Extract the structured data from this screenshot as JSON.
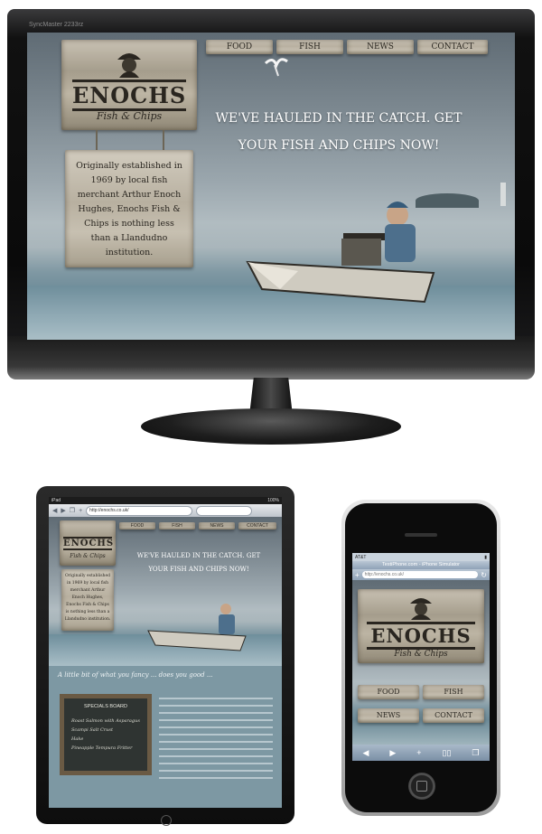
{
  "monitor": {
    "brand": "SyncMaster 2233rz",
    "nav": [
      "FOOD",
      "FISH",
      "NEWS",
      "CONTACT"
    ],
    "logo": {
      "name": "ENOCHS",
      "sub": "Fish & Chips"
    },
    "headline": "WE'VE HAULED IN THE CATCH. GET YOUR FISH AND CHIPS NOW!",
    "intro": "Originally established in 1969 by local fish merchant Arthur Enoch Hughes, Enochs Fish & Chips is nothing less than a Llandudno institution."
  },
  "tablet": {
    "status_left": "iPad",
    "status_right": "100%",
    "url": "http://enochs.co.uk/",
    "nav": [
      "FOOD",
      "FISH",
      "NEWS",
      "CONTACT"
    ],
    "logo": {
      "name": "ENOCHS",
      "sub": "Fish & Chips"
    },
    "headline": "WE'VE HAULED IN THE CATCH. GET YOUR FISH AND CHIPS NOW!",
    "intro": "Originally established in 1969 by local fish merchant Arthur Enoch Hughes, Enochs Fish & Chips is nothing less than a Llandudno institution.",
    "tagline": "A little bit of what you fancy ... does you good ...",
    "board_title": "SPECIALS BOARD",
    "board_lines": [
      "Roast Salmon with Asparagus",
      "Scampi Salt Crust",
      "Hake",
      "Pineapple Tempura Fritter"
    ]
  },
  "phone": {
    "carrier": "AT&T",
    "title": "TestiPhone.com - iPhone Simulator",
    "url": "http://enochs.co.uk/",
    "logo": {
      "name": "ENOCHS",
      "sub": "Fish & Chips"
    },
    "nav": [
      "FOOD",
      "FISH",
      "NEWS",
      "CONTACT"
    ]
  }
}
